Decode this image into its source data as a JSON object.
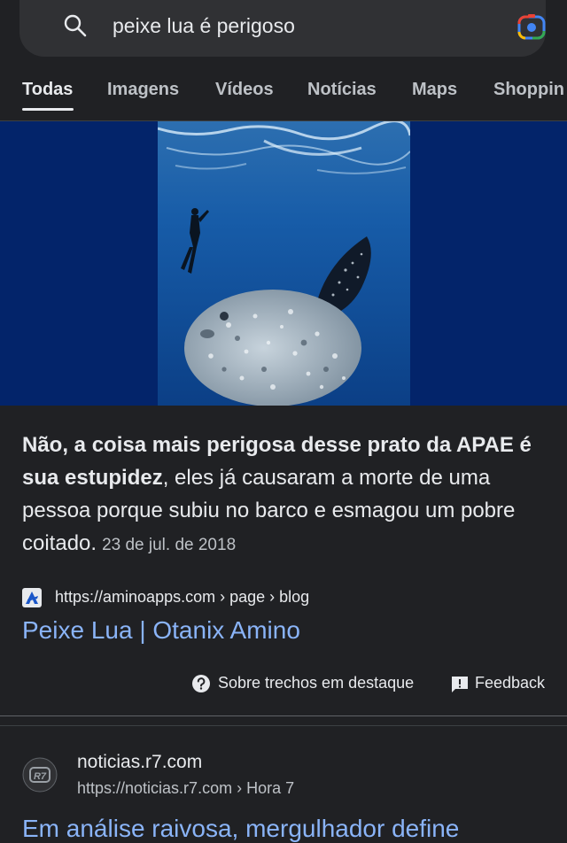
{
  "search": {
    "query": "peixe lua é perigoso"
  },
  "tabs": [
    {
      "label": "Todas",
      "active": true
    },
    {
      "label": "Imagens",
      "active": false
    },
    {
      "label": "Vídeos",
      "active": false
    },
    {
      "label": "Notícias",
      "active": false
    },
    {
      "label": "Maps",
      "active": false
    },
    {
      "label": "Shoppin",
      "active": false
    }
  ],
  "featured_snippet": {
    "image_description_icon": "sunfish-photo",
    "bold_text": "Não, a coisa mais perigosa desse prato da APAE é sua estupidez",
    "rest_text": ", eles já causaram a morte de uma pessoa porque subiu no barco e esmagou um pobre coitado.",
    "date": "23 de jul. de 2018",
    "source_url": "https://aminoapps.com › page › blog",
    "title": "Peixe Lua | Otanix Amino",
    "about_label": "Sobre trechos em destaque",
    "feedback_label": "Feedback"
  },
  "result2": {
    "logo_text": "R7",
    "site": "noticias.r7.com",
    "url": "https://noticias.r7.com › Hora 7",
    "title": "Em análise raivosa, mergulhador define"
  },
  "colors": {
    "background": "#202124",
    "link": "#8ab4f8",
    "hero_bg": "#03246a"
  }
}
